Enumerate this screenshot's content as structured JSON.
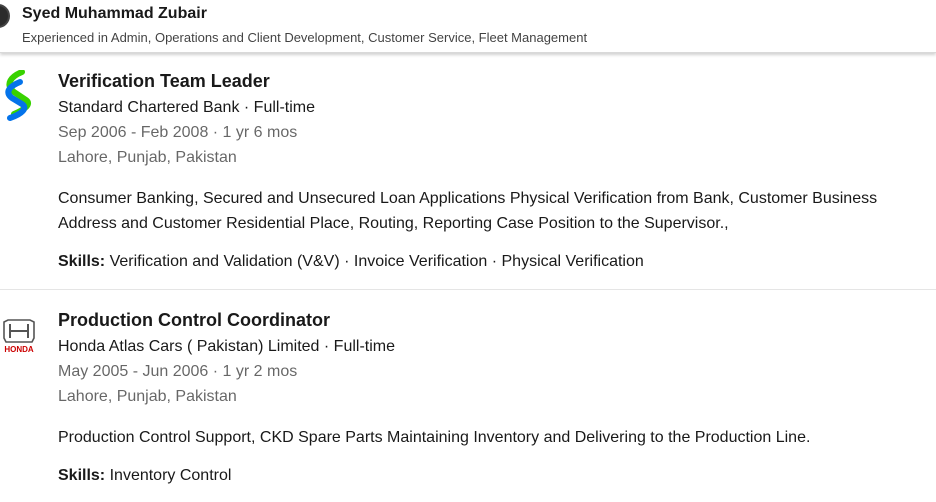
{
  "header": {
    "name": "Syed Muhammad Zubair",
    "headline": "Experienced in Admin, Operations and Client Development, Customer Service, Fleet Management"
  },
  "experience": [
    {
      "logo_icon": "standard-chartered-logo",
      "title": "Verification Team Leader",
      "company": "Standard Chartered Bank · Full-time",
      "dates": "Sep 2006 - Feb 2008 · 1 yr 6 mos",
      "location": "Lahore, Punjab, Pakistan",
      "description_line1": "Consumer Banking, Secured and Unsecured Loan Applications Physical Verification from Bank, Customer Business",
      "description_line2": "Address and Customer Residential Place, Routing, Reporting Case Position to the Supervisor.,",
      "skills_label": "Skills:",
      "skills": "Verification and Validation (V&V) · Invoice Verification · Physical Verification"
    },
    {
      "logo_icon": "honda-logo",
      "logo_text": "HONDA",
      "title": "Production Control Coordinator",
      "company": "Honda Atlas Cars ( Pakistan) Limited · Full-time",
      "dates": "May 2005 - Jun 2006 · 1 yr 2 mos",
      "location": "Lahore, Punjab, Pakistan",
      "description_line1": "Production Control Support, CKD Spare Parts Maintaining Inventory and Delivering to the Production Line.",
      "skills_label": "Skills:",
      "skills": "Inventory Control"
    }
  ],
  "colors": {
    "sc_green": "#38d200",
    "sc_blue": "#0473ea",
    "honda_red": "#cc0000"
  }
}
